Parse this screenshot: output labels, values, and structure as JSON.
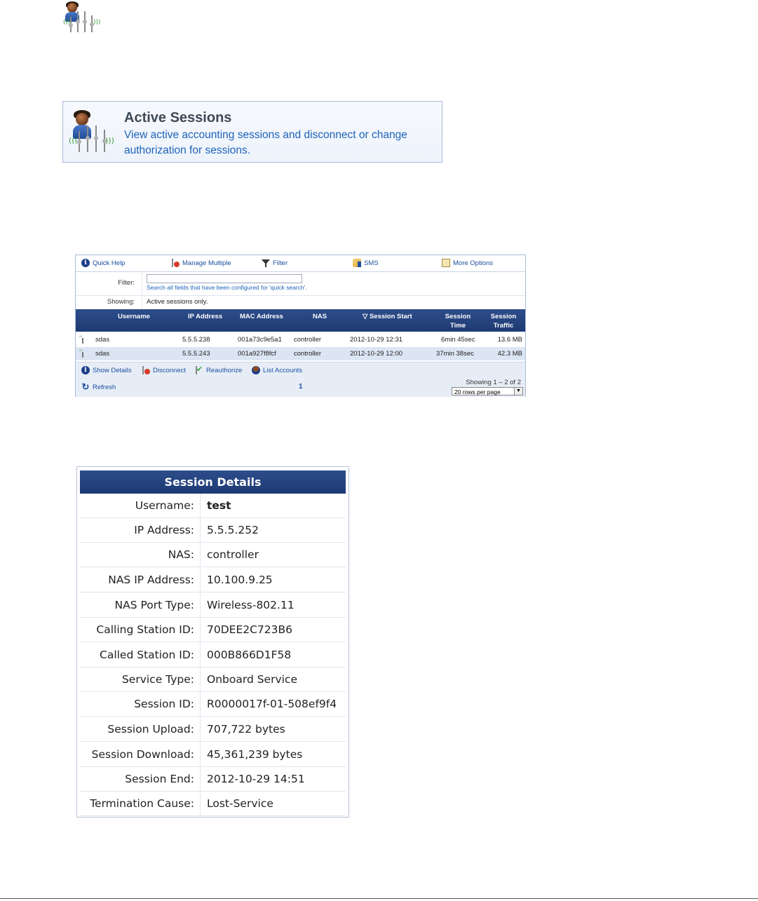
{
  "banner": {
    "title": "Active Sessions",
    "description": "View active accounting sessions and disconnect or change authorization for sessions."
  },
  "toolbar": {
    "quick_help": "Quick Help",
    "manage_multiple": "Manage Multiple",
    "filter": "Filter",
    "sms": "SMS",
    "more_options": "More Options"
  },
  "filter": {
    "label": "Filter:",
    "value": "",
    "hint": "Search all fields that have been configured for 'quick search'."
  },
  "showing": {
    "label": "Showing:",
    "value": "Active sessions only."
  },
  "table": {
    "columns": [
      "Username",
      "IP Address",
      "MAC Address",
      "NAS",
      "▽ Session Start",
      "Session Time",
      "Session Traffic"
    ],
    "rows": [
      [
        "sdas",
        "5.5.5.238",
        "001a73c9e5a1",
        "controller",
        "2012-10-29 12:31",
        "6min 45sec",
        "13.6 MB"
      ],
      [
        "sdas",
        "5.5.5.243",
        "001a927f8fcf",
        "controller",
        "2012-10-29 12:00",
        "37min 38sec",
        "42.3 MB"
      ]
    ]
  },
  "actions": {
    "show_details": "Show Details",
    "disconnect": "Disconnect",
    "reauthorize": "Reauthorize",
    "list_accounts": "List Accounts"
  },
  "footer": {
    "refresh": "Refresh",
    "page": "1",
    "showing_count": "Showing 1 – 2 of 2",
    "rows_per_page": "20 rows per page"
  },
  "details": {
    "title": "Session Details",
    "rows": [
      {
        "label": "Username:",
        "value": "test"
      },
      {
        "label": "IP Address:",
        "value": "5.5.5.252"
      },
      {
        "label": "NAS:",
        "value": "controller"
      },
      {
        "label": "NAS IP Address:",
        "value": "10.100.9.25"
      },
      {
        "label": "NAS Port Type:",
        "value": "Wireless-802.11"
      },
      {
        "label": "Calling Station ID:",
        "value": "70DEE2C723B6"
      },
      {
        "label": "Called Station ID:",
        "value": "000B866D1F58"
      },
      {
        "label": "Service Type:",
        "value": "Onboard Service"
      },
      {
        "label": "Session ID:",
        "value": "R0000017f-01-508ef9f4"
      },
      {
        "label": "Session Upload:",
        "value": "707,722 bytes"
      },
      {
        "label": "Session Download:",
        "value": "45,361,239 bytes"
      },
      {
        "label": "Session End:",
        "value": "2012-10-29 14:51"
      },
      {
        "label": "Termination Cause:",
        "value": "Lost-Service"
      }
    ]
  },
  "colors": {
    "header_blue": "#1e3a72",
    "link_blue": "#1c63b8",
    "row_alt": "#dce5f3"
  },
  "icons": [
    "active-sessions-icon",
    "info-icon",
    "manage-multiple-icon",
    "filter-icon",
    "sms-icon",
    "more-options-icon",
    "antenna-icon",
    "disconnect-icon",
    "reauthorize-icon",
    "account-icon",
    "refresh-icon"
  ]
}
